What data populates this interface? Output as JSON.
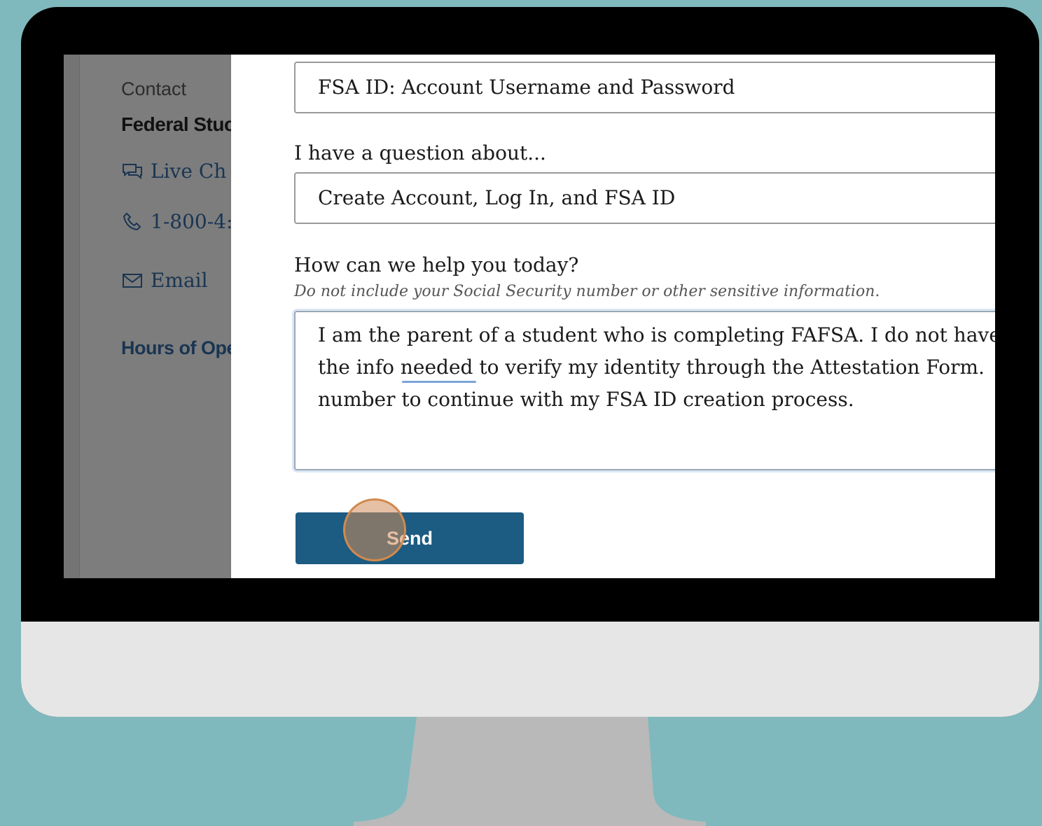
{
  "sidebar": {
    "contact_label": "Contact",
    "org_name": "Federal Stuc",
    "live_chat": "Live Ch",
    "phone": "1-800-4:",
    "email": "Email",
    "hours": "Hours of Ope"
  },
  "form": {
    "topic_value": "FSA ID: Account Username and Password",
    "question_label": "I have a question about...",
    "question_value": "Create Account, Log In, and FSA ID",
    "help_label": "How can we help you today?",
    "help_hint": "Do not include your Social Security number or other sensitive information.",
    "message_lines": [
      "I am the parent of a student who is completing FAFSA. I do not have",
      "the info needed to verify my identity through the Attestation Form.",
      "number to continue with my FSA ID creation process."
    ],
    "send_label": "Send"
  },
  "colors": {
    "background": "#7fb9bd",
    "send_button": "#1c5b82",
    "link": "#1a3552"
  },
  "icons": [
    "chat-icon",
    "phone-icon",
    "mail-icon"
  ]
}
